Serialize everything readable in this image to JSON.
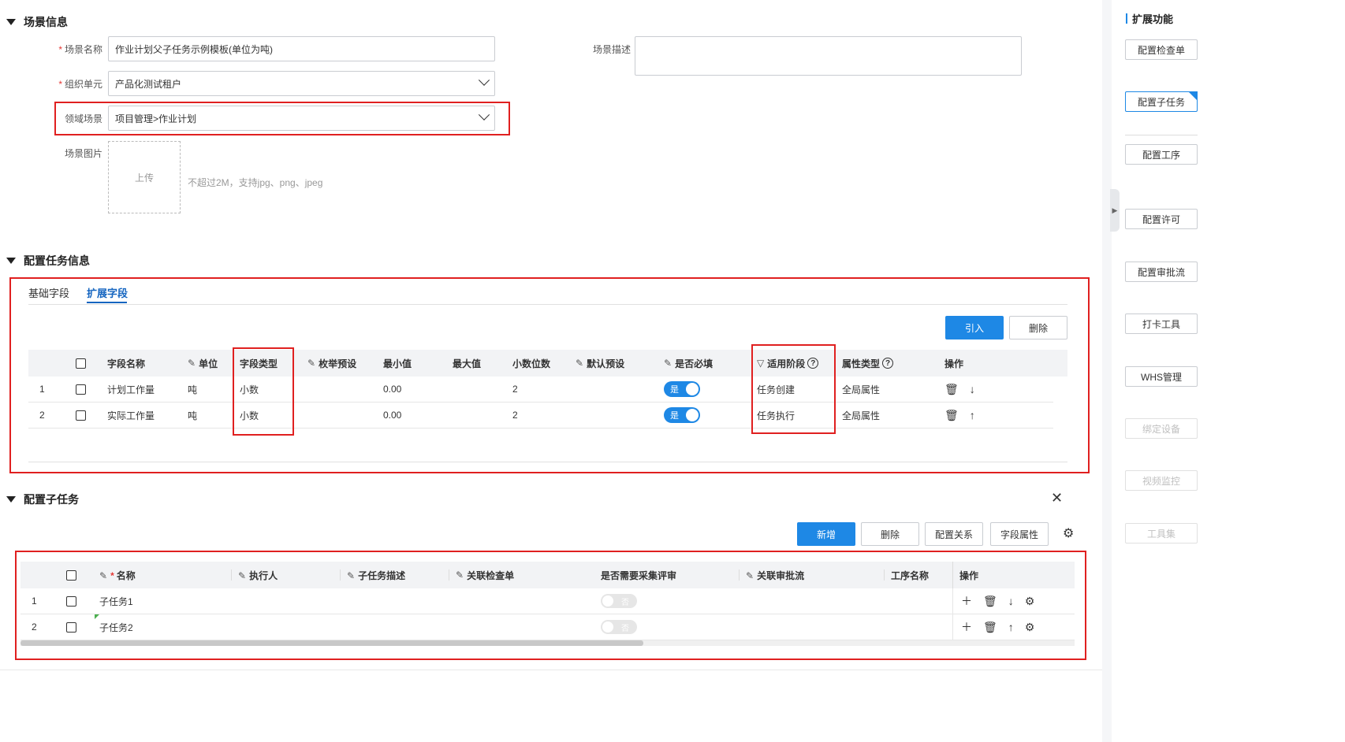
{
  "section1": {
    "title": "场景信息"
  },
  "form": {
    "scene_name": {
      "label": "场景名称",
      "value": "作业计划父子任务示例模板(单位为吨)"
    },
    "scene_desc": {
      "label": "场景描述",
      "value": ""
    },
    "org_unit": {
      "label": "组织单元",
      "value": "产品化测试租户"
    },
    "domain_scene": {
      "label": "领域场景",
      "value": "项目管理>作业计划"
    },
    "scene_image": {
      "label": "场景图片",
      "upload": "上传",
      "hint": "不超过2M，支持jpg、png、jpeg"
    }
  },
  "section2": {
    "title": "配置任务信息",
    "tabs": [
      "基础字段",
      "扩展字段"
    ],
    "buttons": {
      "import": "引入",
      "delete": "删除"
    },
    "headers": {
      "field_name": "字段名称",
      "unit": "单位",
      "field_type": "字段类型",
      "enum_preset": "枚举预设",
      "min": "最小值",
      "max": "最大值",
      "decimals": "小数位数",
      "default_preset": "默认预设",
      "required": "是否必填",
      "stage": "适用阶段",
      "attr_type": "属性类型",
      "ops": "操作"
    },
    "rows": [
      {
        "idx": "1",
        "field_name": "计划工作量",
        "unit": "吨",
        "field_type": "小数",
        "min": "0.00",
        "decimals": "2",
        "required": "是",
        "stage": "任务创建",
        "attr_type": "全局属性"
      },
      {
        "idx": "2",
        "field_name": "实际工作量",
        "unit": "吨",
        "field_type": "小数",
        "min": "0.00",
        "decimals": "2",
        "required": "是",
        "stage": "任务执行",
        "attr_type": "全局属性"
      }
    ]
  },
  "section3": {
    "title": "配置子任务",
    "buttons": {
      "add": "新增",
      "delete": "删除",
      "relation": "配置关系",
      "field_attr": "字段属性"
    },
    "headers": {
      "name": "名称",
      "executor": "执行人",
      "desc": "子任务描述",
      "checklist": "关联检查单",
      "need_review": "是否需要采集评审",
      "approval": "关联审批流",
      "process": "工序名称",
      "ops": "操作"
    },
    "rows": [
      {
        "idx": "1",
        "name": "子任务1",
        "need_review": "否"
      },
      {
        "idx": "2",
        "name": "子任务2",
        "need_review": "否"
      }
    ]
  },
  "right_panel": {
    "title": "扩展功能",
    "group1": [
      "配置检查单",
      "配置子任务",
      "配置工序"
    ],
    "group2": [
      "配置许可",
      "配置审批流",
      "打卡工具",
      "WHS管理"
    ],
    "group3_disabled": [
      "绑定设备",
      "视频监控",
      "工具集"
    ]
  }
}
